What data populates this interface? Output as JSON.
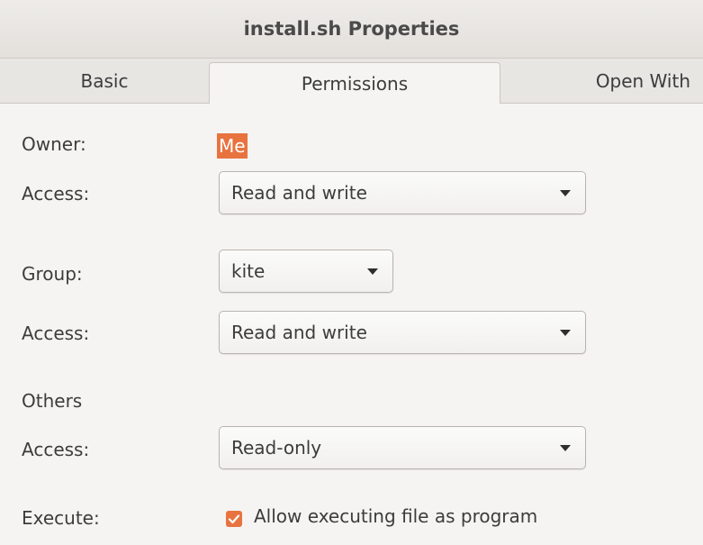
{
  "window": {
    "title": "install.sh Properties"
  },
  "tabs": [
    {
      "label": "Basic"
    },
    {
      "label": "Permissions"
    },
    {
      "label": "Open With"
    }
  ],
  "owner": {
    "label": "Owner:",
    "value": "Me",
    "access_label": "Access:",
    "access_value": "Read and write"
  },
  "group": {
    "label": "Group:",
    "value": "kite",
    "access_label": "Access:",
    "access_value": "Read and write"
  },
  "others": {
    "label": "Others",
    "access_label": "Access:",
    "access_value": "Read-only"
  },
  "execute": {
    "label": "Execute:",
    "checkbox_label": "Allow executing file as program",
    "checked": true
  },
  "colors": {
    "accent": "#e8733f"
  },
  "icons": {
    "dropdown": "chevron-down-icon",
    "check": "checkmark-icon"
  }
}
